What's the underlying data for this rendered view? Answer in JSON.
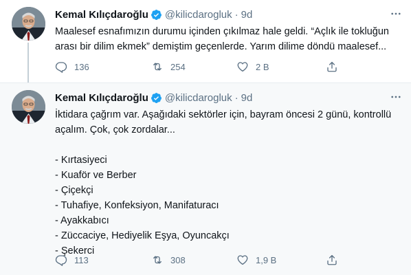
{
  "tweets": [
    {
      "name": "Kemal Kılıçdaroğlu",
      "handle": "@kilicdarogluk",
      "separator": "·",
      "time": "9d",
      "lines": [
        "Maalesef esnafımızın durumu içinden çıkılmaz hale geldi. “Açlık ile tokluğun",
        "arası bir dilim ekmek” demiştim geçenlerde. Yarım dilime döndü maalesef..."
      ],
      "replies": "136",
      "retweets": "254",
      "likes": "2 B"
    },
    {
      "name": "Kemal Kılıçdaroğlu",
      "handle": "@kilicdarogluk",
      "separator": "·",
      "time": "9d",
      "lines": [
        "İktidara çağrım var. Aşağıdaki sektörler için, bayram öncesi 2 günü, kontrollü",
        "açalım. Çok, çok zordalar...",
        "",
        "- Kırtasiyeci",
        "- Kuaför ve Berber",
        "- Çiçekçi",
        "- Tuhafiye, Konfeksiyon, Manifaturacı",
        "- Ayakkabıcı",
        "- Züccaciye, Hediyelik Eşya, Oyuncakçı",
        "- Şekerci"
      ],
      "replies": "113",
      "retweets": "308",
      "likes": "1,9 B"
    }
  ],
  "icons": {
    "verified": "verified-badge-icon",
    "more": "more-dots-icon",
    "reply": "reply-icon",
    "retweet": "retweet-icon",
    "like": "like-heart-icon",
    "share": "share-icon"
  },
  "colors": {
    "verified_blue": "#1da1f2",
    "muted_text": "#5b7083",
    "highlight_background": "#f7f9fa",
    "thread_line": "#c4cfd6"
  }
}
